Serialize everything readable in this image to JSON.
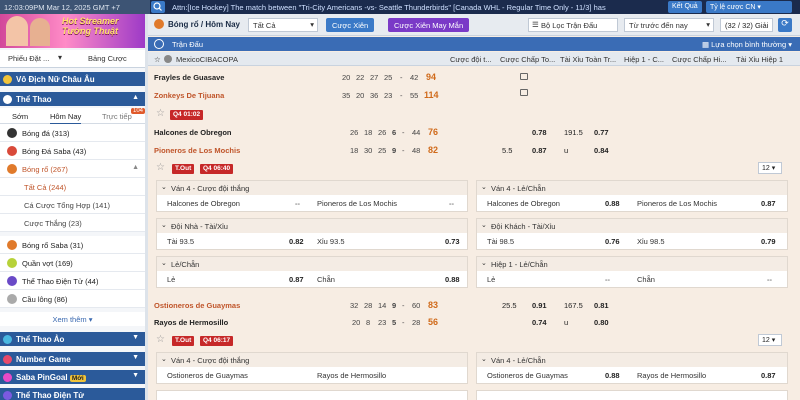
{
  "topbar": {
    "datetime": "12:03:09PM Mar 12, 2025 GMT +7",
    "marquee": "Attn:[Ice Hockey] The match between \"Tri-City Americans -vs- Seattle Thunderbirds\" [Canada WHL - Regular Time Only - 11/3] has",
    "results_label": "Kết Quả",
    "odds_type_label": "Tỷ lệ cược CN"
  },
  "sidebar": {
    "banner_text_1": "Hot Streamer",
    "banner_text_2": "Tướng Thuật",
    "tab_1": "Phiếu Đặt ...",
    "tab_2": "Bảng Cược",
    "sections": {
      "asian_cup": "Vô Địch Nữ Châu Âu",
      "sports": "Thể Thao",
      "virtual": "Thể Thao Ảo",
      "number_game": "Number Game",
      "pingoal": "Saba PinGoal",
      "pingoal_badge": "Mới",
      "esports": "Thể Thao Điện Tử"
    },
    "subtabs": [
      "Sớm",
      "Hôm Nay",
      "Trực tiếp"
    ],
    "live_badge": "104",
    "items": [
      {
        "label": "Bóng đá",
        "count": "(313)"
      },
      {
        "label": "Bóng Đá Saba",
        "count": "(43)"
      },
      {
        "label": "Bóng rổ",
        "count": "(267)"
      },
      {
        "label": "Tất Cả",
        "count": "(244)"
      },
      {
        "label": "Cá Cược Tổng Hợp",
        "count": "(141)"
      },
      {
        "label": "Cược Thắng",
        "count": "(23)"
      },
      {
        "label": "Bóng rổ Saba",
        "count": "(31)"
      },
      {
        "label": "Quần vợt",
        "count": "(169)"
      },
      {
        "label": "Thể Thao Điện Tử",
        "count": "(44)"
      },
      {
        "label": "Cầu lông",
        "count": "(86)"
      }
    ],
    "more_label": "Xem thêm"
  },
  "header": {
    "title": "Bóng rổ / Hôm Nay",
    "filter_all": "Tất Cả",
    "parlay_label": "Cược Xiên",
    "lucky_parlay_label": "Cược Xiên May Mắn",
    "league_filter": "Bộ Lọc Trận Đấu",
    "sort_label": "Từ trước đến nay",
    "count_label": "(32 / 32) Giải"
  },
  "colbar": {
    "left": "Trận Đấu",
    "right": "Lựa chọn bình thường"
  },
  "columns": [
    "Cược đội t...",
    "Cược Chấp To...",
    "Tài Xỉu Toàn Tr...",
    "Hiệp 1 - C...",
    "Cược Chấp Hi...",
    "Tài Xỉu Hiệp 1"
  ],
  "league": "MexicoCIBACOPA",
  "matches": [
    {
      "home": "Frayles de Guasave",
      "away": "Zonkeys De Tijuana",
      "home_q": [
        "20",
        "22",
        "27",
        "25",
        "-",
        "42"
      ],
      "home_total": "94",
      "away_q": [
        "35",
        "20",
        "36",
        "23",
        "-",
        "55"
      ],
      "away_total": "114"
    },
    {
      "home": "Halcones de Obregon",
      "away": "Pioneros de Los Mochis",
      "time_tag": "Q4 01:02",
      "home_q": [
        "26",
        "18",
        "26",
        "6",
        "-",
        "44"
      ],
      "home_total": "76",
      "away_q": [
        "18",
        "30",
        "25",
        "9",
        "-",
        "48"
      ],
      "away_total": "82",
      "hdp_line": "5.5",
      "hdp_home": "0.78",
      "hdp_away": "0.87",
      "ou_line": "191.5",
      "ou_over": "0.77",
      "ou_u": "u",
      "ou_under": "0.84",
      "tags": [
        "T.Out",
        "Q4 06:40"
      ],
      "dd": "12"
    },
    {
      "home": "Ostioneros de Guaymas",
      "away": "Rayos de Hermosillo",
      "home_q": [
        "32",
        "28",
        "14",
        "9",
        "-",
        "60"
      ],
      "home_total": "83",
      "away_q": [
        "20",
        "8",
        "23",
        "5",
        "-",
        "28"
      ],
      "away_total": "56",
      "hdp_line": "25.5",
      "hdp_home": "0.91",
      "hdp_away": "0.74",
      "ou_line": "167.5",
      "ou_over": "0.81",
      "ou_u": "u",
      "ou_under": "0.80",
      "tags": [
        "T.Out",
        "Q4 06:17"
      ],
      "dd": "12"
    }
  ],
  "panels_1": [
    {
      "title": "Ván 4 - Cược đội thắng",
      "a": "Halcones de Obregon",
      "av": "--",
      "b": "Pioneros de Los Mochis",
      "bv": "--"
    },
    {
      "title": "Ván 4 - Lẻ/Chẵn",
      "a": "Halcones de Obregon",
      "av": "0.88",
      "b": "Pioneros de Los Mochis",
      "bv": "0.87"
    },
    {
      "title": "Đội Nhà - Tài/Xỉu",
      "a": "Tài 93.5",
      "av": "0.82",
      "b": "Xỉu 93.5",
      "bv": "0.73"
    },
    {
      "title": "Đội Khách - Tài/Xỉu",
      "a": "Tài 98.5",
      "av": "0.76",
      "b": "Xỉu 98.5",
      "bv": "0.79"
    },
    {
      "title": "Lẻ/Chẵn",
      "a": "Lẻ",
      "av": "0.87",
      "b": "Chẵn",
      "bv": "0.88"
    },
    {
      "title": "Hiệp 1 - Lẻ/Chẵn",
      "a": "Lẻ",
      "av": "--",
      "b": "Chẵn",
      "bv": "--"
    }
  ],
  "panels_2": [
    {
      "title": "Ván 4 - Cược đội thắng",
      "a": "Ostioneros de Guaymas",
      "av": "",
      "b": "Rayos de Hermosillo",
      "bv": ""
    },
    {
      "title": "Ván 4 - Lẻ/Chẵn",
      "a": "Ostioneros de Guaymas",
      "av": "0.88",
      "b": "Rayos de Hermosillo",
      "bv": "0.87"
    }
  ]
}
